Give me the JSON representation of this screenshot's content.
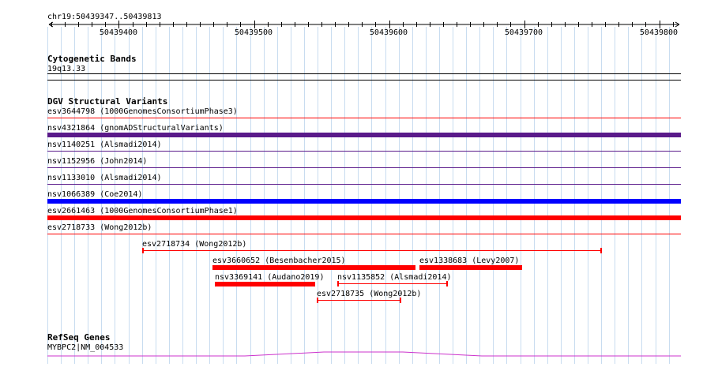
{
  "ruler": {
    "location": "chr19:50439347..50439813",
    "ticks": [
      "50439400",
      "50439500",
      "50439600",
      "50439700",
      "50439800"
    ]
  },
  "cytoband": {
    "title": "Cytogenetic Bands",
    "band": "19q13.33"
  },
  "dgv": {
    "title": "DGV Structural Variants",
    "full_width_features": [
      {
        "id": "esv3644798",
        "label": "esv3644798 (1000GenomesConsortiumPhase3)",
        "color": "#ff0000",
        "style": "thin"
      },
      {
        "id": "nsv4321864",
        "label": "nsv4321864 (gnomADStructuralVariants)",
        "color": "#5a1a8a",
        "style": "thick"
      },
      {
        "id": "nsv1140251",
        "label": "nsv1140251 (Alsmadi2014)",
        "color": "#5a1a8a",
        "style": "thin"
      },
      {
        "id": "nsv1152956",
        "label": "nsv1152956 (John2014)",
        "color": "#5a1a8a",
        "style": "thin"
      },
      {
        "id": "nsv1133010",
        "label": "nsv1133010 (Alsmadi2014)",
        "color": "#5a1a8a",
        "style": "thin"
      },
      {
        "id": "nsv1066389",
        "label": "nsv1066389 (Coe2014)",
        "color": "#0000ff",
        "style": "thick"
      },
      {
        "id": "esv2661463",
        "label": "esv2661463 (1000GenomesConsortiumPhase1)",
        "color": "#ff0000",
        "style": "thick"
      },
      {
        "id": "esv2718733",
        "label": "esv2718733 (Wong2012b)",
        "color": "#ff0000",
        "style": "thin"
      }
    ],
    "partial_features": [
      {
        "id": "esv2718734",
        "label": "esv2718734 (Wong2012b)",
        "color": "#ff0000",
        "style": "interval"
      },
      {
        "id": "esv3660652",
        "label": "esv3660652 (Besenbacher2015)",
        "color": "#ff0000",
        "style": "thick"
      },
      {
        "id": "esv1338683",
        "label": "esv1338683 (Levy2007)",
        "color": "#ff0000",
        "style": "thick"
      },
      {
        "id": "nsv3369141",
        "label": "nsv3369141 (Audano2019)",
        "color": "#ff0000",
        "style": "thick"
      },
      {
        "id": "nsv1135852",
        "label": "nsv1135852 (Alsmadi2014)",
        "color": "#ff0000",
        "style": "interval"
      },
      {
        "id": "esv2718735",
        "label": "esv2718735 (Wong2012b)",
        "color": "#ff0000",
        "style": "interval"
      }
    ]
  },
  "refseq": {
    "title": "RefSeq Genes",
    "gene_label": "MYBPC2|NM_004533",
    "color": "#cc33cc"
  },
  "colors": {
    "grid": "#c8dcf0",
    "text": "#000000"
  }
}
